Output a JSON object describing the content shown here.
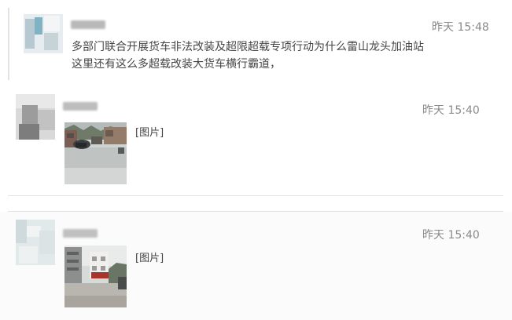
{
  "messages": [
    {
      "time": "昨天 15:48",
      "text_lines": [
        "多部门联合开展货车非法改装及超限超载专项行动为什么雷山龙头加油站",
        "这里还有这么多超载改装大货车横行霸道，"
      ]
    },
    {
      "time": "昨天 15:40",
      "content": "[图片]"
    },
    {
      "time": "昨天 15:40",
      "content": "[图片]"
    }
  ]
}
